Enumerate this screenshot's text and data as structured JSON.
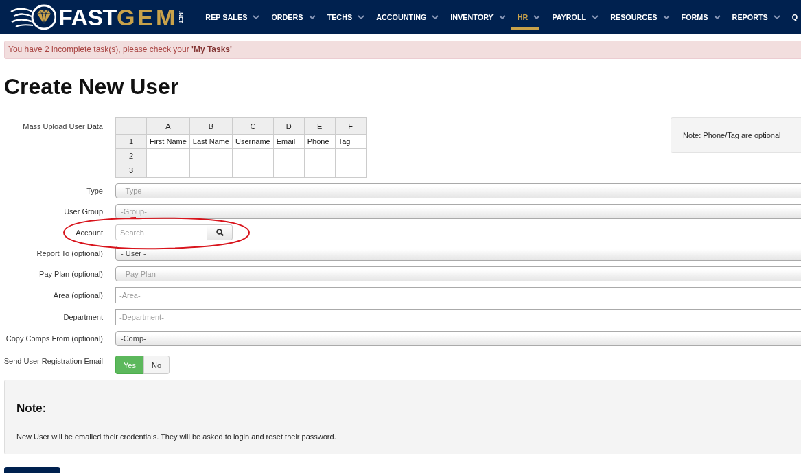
{
  "nav": {
    "logo": {
      "wordmark": "FAST",
      "accent": "GEM",
      "suffix": ".NET"
    },
    "items": [
      {
        "label": "REP SALES",
        "selected": false,
        "dropdown": true
      },
      {
        "label": "ORDERS",
        "selected": false,
        "dropdown": true
      },
      {
        "label": "TECHS",
        "selected": false,
        "dropdown": true
      },
      {
        "label": "ACCOUNTING",
        "selected": false,
        "dropdown": true
      },
      {
        "label": "INVENTORY",
        "selected": false,
        "dropdown": true
      },
      {
        "label": "HR",
        "selected": true,
        "dropdown": true
      },
      {
        "label": "PAYROLL",
        "selected": false,
        "dropdown": true
      },
      {
        "label": "RESOURCES",
        "selected": false,
        "dropdown": true
      },
      {
        "label": "FORMS",
        "selected": false,
        "dropdown": true
      },
      {
        "label": "REPORTS",
        "selected": false,
        "dropdown": true
      },
      {
        "label": "Q",
        "selected": false,
        "dropdown": false
      }
    ]
  },
  "alert": {
    "message": "You have 2 incomplete task(s), please check your **'My Tasks'**"
  },
  "title": "Create New User",
  "form": {
    "fields": [
      {
        "kind": "grid",
        "label": "Mass Upload User Data",
        "columns": [
          "A",
          "B",
          "C",
          "D",
          "E",
          "F"
        ],
        "rows": [
          {
            "number": "1",
            "cells": [
              "First Name",
              "Last Name",
              "Username",
              "Email",
              "Phone",
              "Tag"
            ]
          },
          {
            "number": "2"
          },
          {
            "number": "3"
          }
        ],
        "note": "Note: Phone/Tag are optional"
      },
      {
        "kind": "select",
        "label": "Type",
        "placeholder": "- Type -"
      },
      {
        "kind": "select",
        "label": "User Group",
        "placeholder": "-Group-"
      },
      {
        "kind": "search",
        "label": "Account",
        "placeholder": "Search",
        "circled": true
      },
      {
        "kind": "select",
        "label": "Report To (optional)",
        "value": "- User -"
      },
      {
        "kind": "select",
        "label": "Pay Plan (optional)",
        "placeholder": "- Pay Plan -"
      },
      {
        "kind": "text",
        "label": "Area (optional)",
        "placeholder": "-Area-"
      },
      {
        "kind": "text",
        "label": "Department",
        "placeholder": "-Department-"
      },
      {
        "kind": "select",
        "label": "Copy Comps From (optional)",
        "value": "-Comp-"
      },
      {
        "kind": "toggle",
        "label": "Send User Registration Email",
        "options": [
          {
            "label": "Yes",
            "selected": true
          },
          {
            "label": "No",
            "selected": false
          }
        ]
      }
    ]
  },
  "note_panel": {
    "title": "Note:",
    "text": "New User will be emailed their credentials. They will be asked to login and reset their password."
  }
}
